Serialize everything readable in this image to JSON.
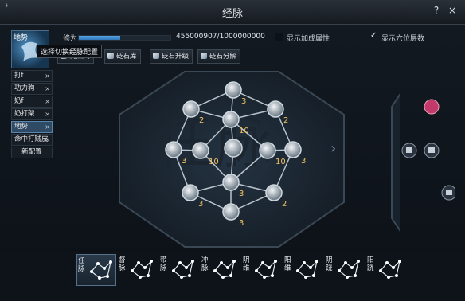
{
  "window": {
    "title": "经脉",
    "corner": "ᅡ",
    "help": "?",
    "close": "×"
  },
  "profile": {
    "name": "地势",
    "tooltip": "选择切换经脉配置"
  },
  "configs": [
    {
      "label": "打f",
      "close": "×"
    },
    {
      "label": "功力狗",
      "close": "×"
    },
    {
      "label": "奶f",
      "close": "×"
    },
    {
      "label": "奶打架",
      "close": "×"
    },
    {
      "label": "地势",
      "close": "×",
      "selected": true
    },
    {
      "label": "命中打贼皮",
      "close": "×"
    }
  ],
  "new_config": "新配置",
  "cultivation": {
    "label": "修为",
    "value": "455000907/1000000000",
    "fraction": 0.455
  },
  "options": {
    "show_bonus": {
      "label": "显示加成属性",
      "checked": false
    },
    "show_layers": {
      "label": "显示穴位层数",
      "checked": true
    }
  },
  "toolbar": [
    {
      "label": "洗点穴"
    },
    {
      "label": "砭石库"
    },
    {
      "label": "砭石升级"
    },
    {
      "label": "砭石分解"
    }
  ],
  "board_watermark": "任脉",
  "nodes": [
    {
      "id": "n1",
      "value": "3"
    },
    {
      "id": "n2",
      "value": "2"
    },
    {
      "id": "n3",
      "value": "10"
    },
    {
      "id": "n4",
      "value": "2"
    },
    {
      "id": "n5",
      "value": "3"
    },
    {
      "id": "n6",
      "value": "10"
    },
    {
      "id": "n7",
      "value": ""
    },
    {
      "id": "n8",
      "value": "10"
    },
    {
      "id": "n9",
      "value": "3"
    },
    {
      "id": "n10",
      "value": "3"
    },
    {
      "id": "n11",
      "value": "3"
    },
    {
      "id": "n12",
      "value": "2"
    },
    {
      "id": "n13",
      "value": "3"
    }
  ],
  "meridians": [
    {
      "label": "任脉",
      "selected": true
    },
    {
      "label": "督脉"
    },
    {
      "label": "带脉"
    },
    {
      "label": "冲脉"
    },
    {
      "label": "阴维"
    },
    {
      "label": "阳维"
    },
    {
      "label": "阴跷"
    },
    {
      "label": "阳跷"
    }
  ],
  "colors": {
    "accent": "#5aa8e8",
    "node_value": "#f2c463",
    "line": "#b9c4ce"
  }
}
